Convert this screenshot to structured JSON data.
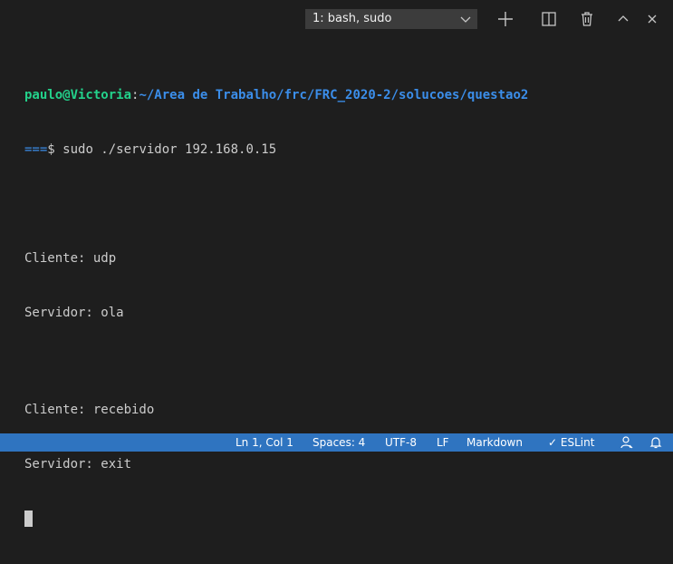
{
  "colors": {
    "background": "#1e1e1e",
    "dropdown_bg": "#3c3c3c",
    "statusbar_bg": "#2f74c0",
    "prompt_user": "#23d18b",
    "prompt_path": "#3b8eea",
    "text": "#cccccc"
  },
  "header": {
    "terminal_select": "1: bash, sudo",
    "icons": [
      "chevron-down-icon",
      "plus-icon",
      "split-icon",
      "trash-icon",
      "chevron-up-icon",
      "close-icon"
    ]
  },
  "terminal": {
    "prompt_user": "paulo@Victoria",
    "prompt_sep": ":",
    "prompt_path": "~/Area de Trabalho/frc/FRC_2020-2/solucoes/questao2",
    "prompt_eq": "===",
    "prompt_dollar": "$ ",
    "command": "sudo ./servidor 192.168.0.15",
    "lines": [
      "Cliente: udp",
      "Servidor: ola",
      "Cliente: recebido",
      "Servidor: exit"
    ]
  },
  "statusbar": {
    "position": "Ln 1, Col 1",
    "spaces": "Spaces: 4",
    "encoding": "UTF-8",
    "eol": "LF",
    "language": "Markdown",
    "eslint": "✓ ESLint",
    "icons": [
      "person-icon",
      "bell-icon"
    ]
  }
}
